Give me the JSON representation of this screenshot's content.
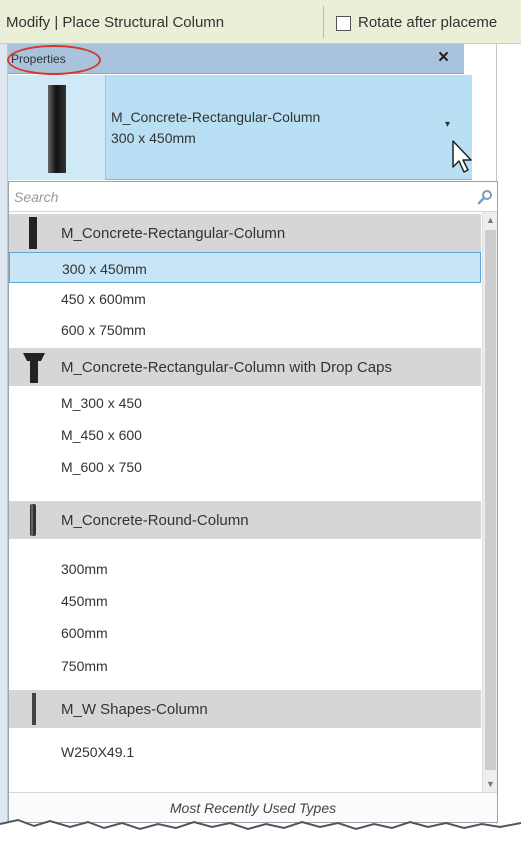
{
  "ribbon": {
    "title": "Modify | Place Structural Column",
    "rotate_label": "Rotate after placeme"
  },
  "properties": {
    "title": "Properties",
    "close_glyph": "×"
  },
  "type_selector": {
    "family": "M_Concrete-Rectangular-Column",
    "type": "300 x 450mm",
    "arrow_glyph": "▾"
  },
  "search": {
    "placeholder": "Search"
  },
  "groups": [
    {
      "family": "M_Concrete-Rectangular-Column",
      "icon": "rectangular-column-icon",
      "types": [
        "300 x 450mm",
        "450 x 600mm",
        "600 x 750mm"
      ]
    },
    {
      "family": "M_Concrete-Rectangular-Column with Drop Caps",
      "icon": "drop-cap-column-icon",
      "types": [
        "M_300 x 450",
        "M_450 x 600",
        "M_600 x 750"
      ]
    },
    {
      "family": "M_Concrete-Round-Column",
      "icon": "round-column-icon",
      "types": [
        "300mm",
        "450mm",
        "600mm",
        "750mm"
      ]
    },
    {
      "family": "M_W Shapes-Column",
      "icon": "steel-column-icon",
      "types": [
        "W250X49.1"
      ]
    }
  ],
  "selected_type": "300 x 450mm",
  "footer": {
    "label": "Most Recently Used Types"
  },
  "colors": {
    "ribbon": "#eaf0d8",
    "header": "#a9c3dc",
    "selector": "#b8dff3",
    "selected_row": "#c8e4f7",
    "family_row": "#d6d6d6",
    "highlight_circle": "#d33a2a"
  }
}
